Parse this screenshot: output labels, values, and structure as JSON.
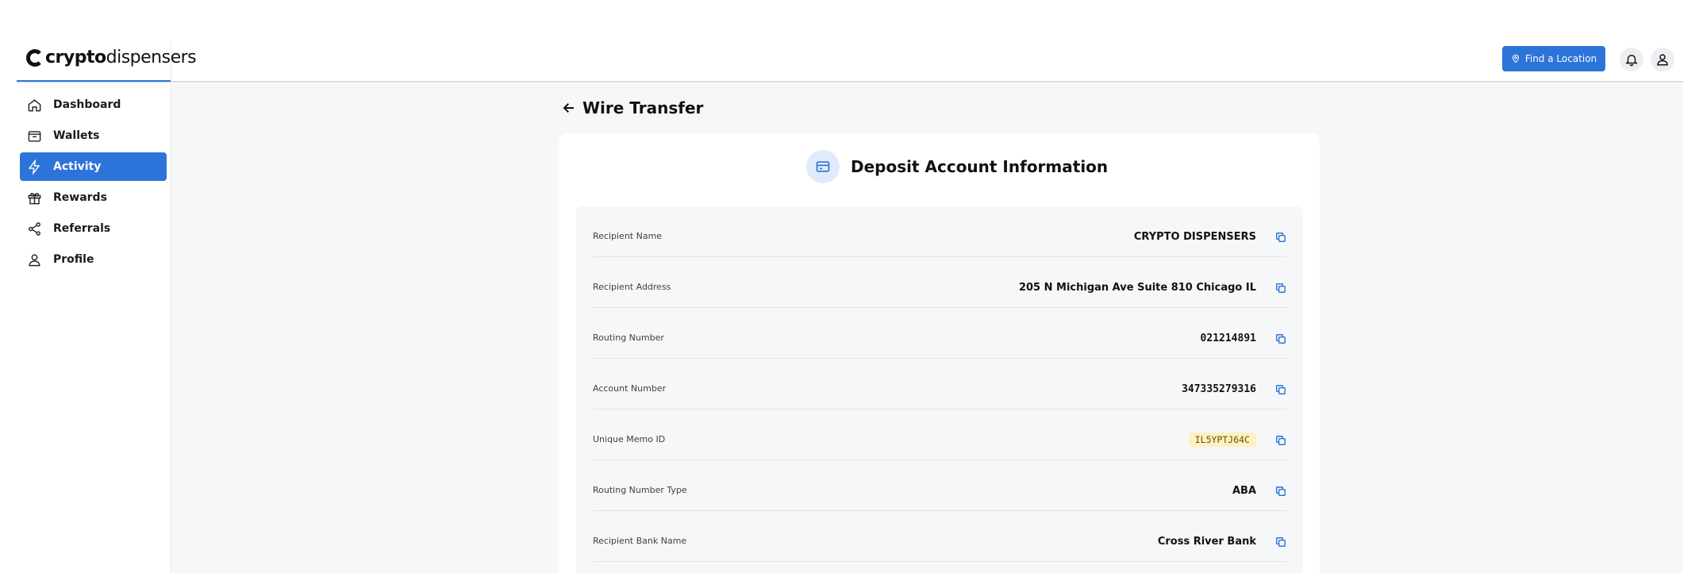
{
  "brand": {
    "name_bold": "crypto",
    "name_light": "dispensers"
  },
  "header": {
    "find_location_label": "Find a Location",
    "accent_color": "#2d74da"
  },
  "sidebar": {
    "items": [
      {
        "label": "Dashboard",
        "icon": "home-icon",
        "active": false
      },
      {
        "label": "Wallets",
        "icon": "wallet-icon",
        "active": false
      },
      {
        "label": "Activity",
        "icon": "lightning-icon",
        "active": true
      },
      {
        "label": "Rewards",
        "icon": "gift-icon",
        "active": false
      },
      {
        "label": "Referrals",
        "icon": "share-icon",
        "active": false
      },
      {
        "label": "Profile",
        "icon": "user-icon",
        "active": false
      }
    ]
  },
  "main": {
    "title": "Wire Transfer",
    "card_title": "Deposit Account Information",
    "fields": [
      {
        "label": "Recipient Name",
        "value": "CRYPTO DISPENSERS"
      },
      {
        "label": "Recipient Address",
        "value": "205 N Michigan Ave Suite 810 Chicago IL"
      },
      {
        "label": "Routing Number",
        "value": "021214891"
      },
      {
        "label": "Account Number",
        "value": "347335279316"
      },
      {
        "label": "Unique Memo ID",
        "value": "IL5YPTJ64C"
      },
      {
        "label": "Routing Number Type",
        "value": "ABA"
      },
      {
        "label": "Recipient Bank Name",
        "value": "Cross River Bank"
      }
    ]
  }
}
